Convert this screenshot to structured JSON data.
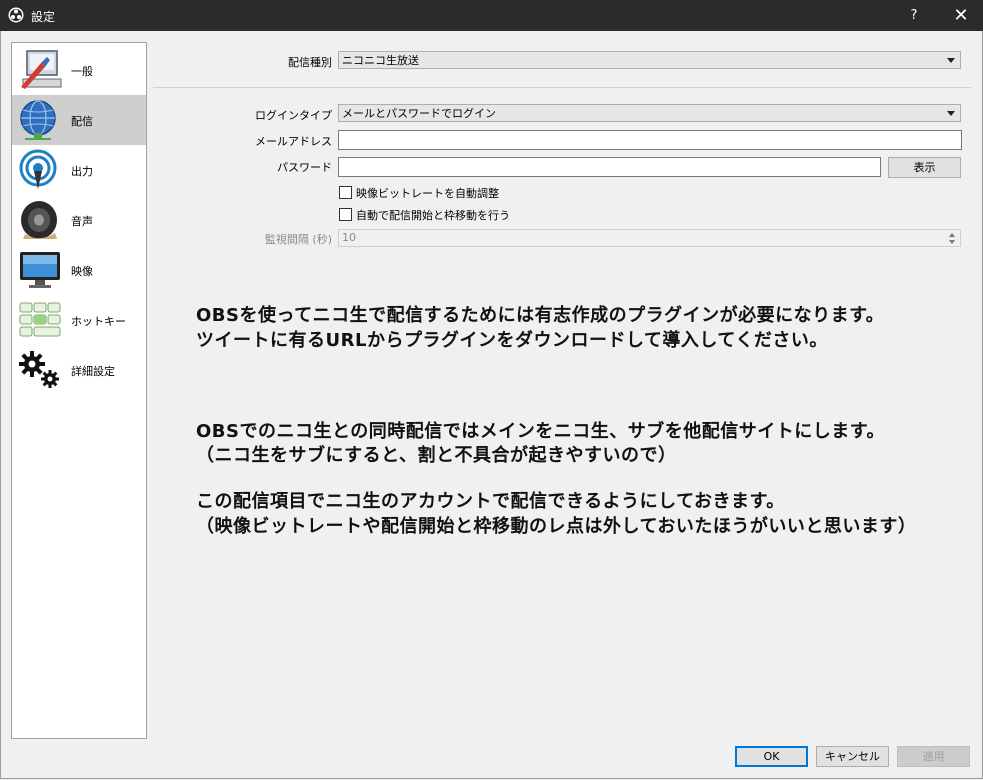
{
  "window": {
    "title": "設定",
    "help": "?",
    "close": "✕"
  },
  "sidebar": {
    "items": [
      {
        "label": "一般",
        "icon": "general-icon"
      },
      {
        "label": "配信",
        "icon": "stream-globe-icon"
      },
      {
        "label": "出力",
        "icon": "output-antenna-icon"
      },
      {
        "label": "音声",
        "icon": "speaker-icon"
      },
      {
        "label": "映像",
        "icon": "monitor-icon"
      },
      {
        "label": "ホットキー",
        "icon": "keyboard-icon"
      },
      {
        "label": "詳細設定",
        "icon": "gears-icon"
      }
    ],
    "selected_index": 1
  },
  "stream": {
    "service_label": "配信種別",
    "service_value": "ニコニコ生放送",
    "login_type_label": "ログインタイプ",
    "login_type_value": "メールとパスワードでログイン",
    "email_label": "メールアドレス",
    "email_value": "",
    "password_label": "パスワード",
    "password_value": "",
    "show_button": "表示",
    "checkbox_bitrate": "映像ビットレートを自動調整",
    "checkbox_autostart": "自動で配信開始と枠移動を行う",
    "interval_label": "監視間隔 (秒)",
    "interval_value": "10"
  },
  "notes": {
    "line1": "OBSを使ってニコ生で配信するためには有志作成のプラグインが必要になります。",
    "line2": "ツイートに有るURLからプラグインをダウンロードして導入してください。",
    "line3": "OBSでのニコ生との同時配信ではメインをニコ生、サブを他配信サイトにします。",
    "line4": "（ニコ生をサブにすると、割と不具合が起きやすいので）",
    "line5": "この配信項目でニコ生のアカウントで配信できるようにしておきます。",
    "line6": "（映像ビットレートや配信開始と枠移動のレ点は外しておいたほうがいいと思います）"
  },
  "buttons": {
    "ok": "OK",
    "cancel": "キャンセル",
    "apply": "適用"
  }
}
